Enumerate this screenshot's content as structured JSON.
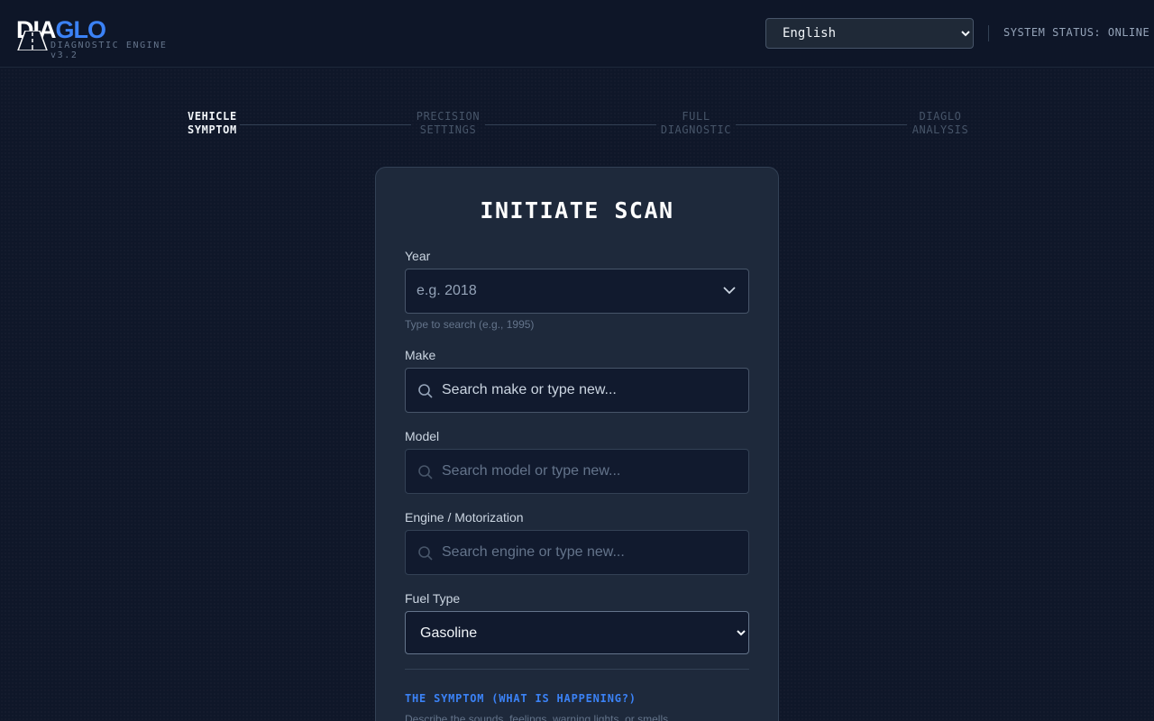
{
  "header": {
    "logo": {
      "part1": "DIA",
      "part2": "GLO"
    },
    "tagline": "DIAGNOSTIC ENGINE v3.2",
    "language": {
      "selected": "English"
    },
    "status": "SYSTEM STATUS: ONLINE"
  },
  "stepper": {
    "steps": [
      {
        "line1": "VEHICLE",
        "line2": "SYMPTOM",
        "active": true
      },
      {
        "line1": "PRECISION",
        "line2": "SETTINGS",
        "active": false
      },
      {
        "line1": "FULL",
        "line2": "DIAGNOSTIC",
        "active": false
      },
      {
        "line1": "DIAGLO",
        "line2": "ANALYSIS",
        "active": false
      }
    ]
  },
  "form": {
    "title": "INITIATE SCAN",
    "year": {
      "label": "Year",
      "placeholder": "e.g. 2018",
      "help": "Type to search (e.g., 1995)"
    },
    "make": {
      "label": "Make",
      "placeholder": "Search make or type new..."
    },
    "model": {
      "label": "Model",
      "placeholder": "Search model or type new..."
    },
    "engine": {
      "label": "Engine / Motorization",
      "placeholder": "Search engine or type new..."
    },
    "fuel": {
      "label": "Fuel Type",
      "selected": "Gasoline"
    },
    "symptom": {
      "heading": "THE SYMPTOM (WHAT IS HAPPENING?)",
      "description": "Describe the sounds, feelings, warning lights, or smells..."
    }
  },
  "colors": {
    "accent": "#3b82f6",
    "background": "#0f1729",
    "card": "#1e293b"
  }
}
